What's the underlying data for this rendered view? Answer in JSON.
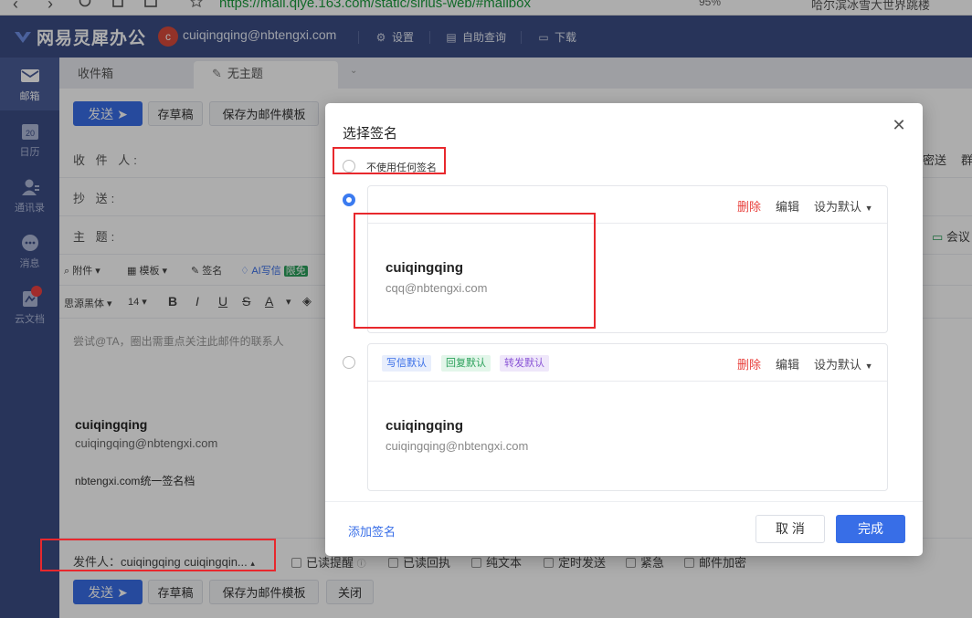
{
  "browser": {
    "back_glyph": "‹",
    "forward_glyph": "›",
    "url": "https://mail.qiye.163.com/static/sirius-web/#mailbox",
    "zoom": "95%",
    "extension_text": "哈尔滨冰雪大世界跳楼"
  },
  "topbar": {
    "logo": "网易灵犀办公",
    "avatar_letter": "c",
    "account": "cuiqingqing@nbtengxi.com",
    "settings": "设置",
    "self_query": "自助查询",
    "download": "下载"
  },
  "leftnav": {
    "items": [
      {
        "label": "邮箱",
        "icon": "mail-icon"
      },
      {
        "label": "日历",
        "icon": "calendar-icon",
        "date": "20"
      },
      {
        "label": "通讯录",
        "icon": "contacts-icon"
      },
      {
        "label": "消息",
        "icon": "message-icon"
      },
      {
        "label": "云文档",
        "icon": "cloud-doc-icon"
      }
    ]
  },
  "tabs": {
    "inbox": "收件箱",
    "draft": "无主题"
  },
  "toolbar": {
    "send": "发送",
    "save_draft": "存草稿",
    "save_template": "保存为邮件模板",
    "close": "关闭"
  },
  "fields": {
    "to": "收 件 人:",
    "cc": "抄    送:",
    "subject": "主    题:",
    "bcc": "密送",
    "group": "群",
    "meeting": "会议"
  },
  "format": {
    "attach": "附件",
    "template": "模板",
    "signature": "签名",
    "ai_write": "AI写信",
    "limited_free": "限免",
    "font": "思源黑体",
    "size": "14"
  },
  "body": {
    "placeholder": "尝试@TA，圈出需重点关注此邮件的联系人",
    "sig_name": "cuiqingqing",
    "sig_mail": "cuiqingqing@nbtengxi.com",
    "sig_doc": "nbtengxi.com统一签名档"
  },
  "bottom": {
    "sender": "发件人：cuiqingqing cuiqingqin...",
    "options": [
      "已读提醒",
      "已读回执",
      "纯文本",
      "定时发送",
      "紧急",
      "邮件加密"
    ]
  },
  "dialog": {
    "title": "选择签名",
    "none_option": "不使用任何签名",
    "actions": {
      "delete": "删除",
      "edit": "编辑",
      "set_default": "设为默认"
    },
    "card1": {
      "name": "cuiqingqing",
      "mail": "cqq@nbtengxi.com",
      "selected": true
    },
    "card2": {
      "name": "cuiqingqing",
      "mail": "cuiqingqing@nbtengxi.com",
      "tags": [
        "写信默认",
        "回复默认",
        "转发默认"
      ]
    },
    "add_signature": "添加签名",
    "cancel": "取 消",
    "done": "完成"
  },
  "colors": {
    "brand": "#3b4d85",
    "primary": "#386ee7",
    "danger": "#e8413d",
    "highlight_box": "#e8282d"
  }
}
